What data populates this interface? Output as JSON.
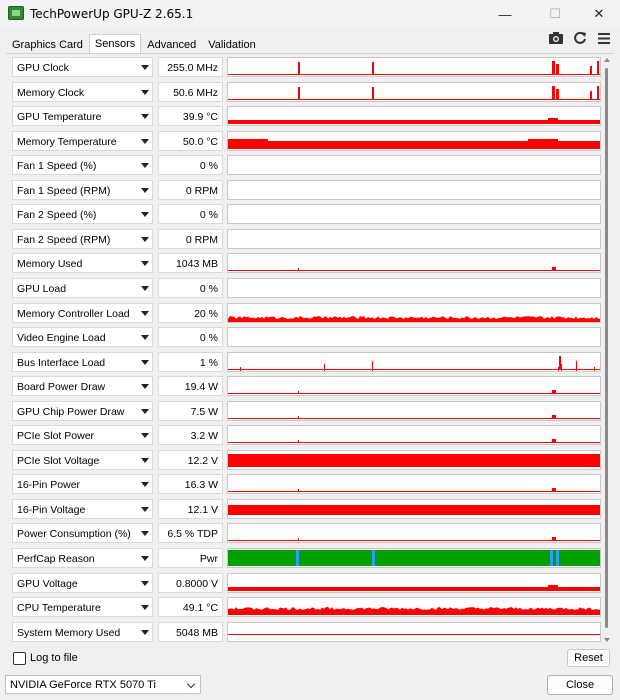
{
  "window": {
    "title": "TechPowerUp GPU-Z 2.65.1",
    "minimize_glyph": "—",
    "maximize_glyph": "☐",
    "close_glyph": "✕"
  },
  "tabs": [
    {
      "label": "Graphics Card"
    },
    {
      "label": "Sensors",
      "active": true
    },
    {
      "label": "Advanced"
    },
    {
      "label": "Validation"
    }
  ],
  "toolbar_icons": [
    "camera-icon",
    "refresh-icon",
    "menu-icon"
  ],
  "sensors": [
    {
      "name": "GPU Clock",
      "value": "255.0 MHz",
      "trend": "spikes"
    },
    {
      "name": "Memory Clock",
      "value": "50.6 MHz",
      "trend": "spikes"
    },
    {
      "name": "GPU Temperature",
      "value": "39.9 °C",
      "trend": "low-band"
    },
    {
      "name": "Memory Temperature",
      "value": "50.0 °C",
      "trend": "band"
    },
    {
      "name": "Fan 1 Speed (%)",
      "value": "0 %",
      "trend": "none"
    },
    {
      "name": "Fan 1 Speed (RPM)",
      "value": "0 RPM",
      "trend": "none"
    },
    {
      "name": "Fan 2 Speed (%)",
      "value": "0 %",
      "trend": "none"
    },
    {
      "name": "Fan 2 Speed (RPM)",
      "value": "0 RPM",
      "trend": "none"
    },
    {
      "name": "Memory Used",
      "value": "1043 MB",
      "trend": "line"
    },
    {
      "name": "GPU Load",
      "value": "0 %",
      "trend": "none"
    },
    {
      "name": "Memory Controller Load",
      "value": "20 %",
      "trend": "noisy"
    },
    {
      "name": "Video Engine Load",
      "value": "0 %",
      "trend": "none"
    },
    {
      "name": "Bus Interface Load",
      "value": "1 %",
      "trend": "spikes-small"
    },
    {
      "name": "Board Power Draw",
      "value": "19.4 W",
      "trend": "line"
    },
    {
      "name": "GPU Chip Power Draw",
      "value": "7.5 W",
      "trend": "line"
    },
    {
      "name": "PCIe Slot Power",
      "value": "3.2 W",
      "trend": "line"
    },
    {
      "name": "PCIe Slot Voltage",
      "value": "12.2 V",
      "trend": "full"
    },
    {
      "name": "16-Pin Power",
      "value": "16.3 W",
      "trend": "line"
    },
    {
      "name": "16-Pin Voltage",
      "value": "12.1 V",
      "trend": "full-low"
    },
    {
      "name": "Power Consumption (%)",
      "value": "6.5 % TDP",
      "trend": "line"
    },
    {
      "name": "PerfCap Reason",
      "value": "Pwr",
      "trend": "perfcap"
    },
    {
      "name": "GPU Voltage",
      "value": "0.8000 V",
      "trend": "low-band"
    },
    {
      "name": "CPU Temperature",
      "value": "49.1 °C",
      "trend": "noisy-band"
    },
    {
      "name": "System Memory Used",
      "value": "5048 MB",
      "trend": "mid-line"
    }
  ],
  "colors": {
    "graph_red": "#ff0000",
    "perfcap_green": "#00a000",
    "perfcap_blue": "#3399ff"
  },
  "footer": {
    "log_to_file_label": "Log to file",
    "log_to_file_checked": false,
    "reset_label": "Reset",
    "gpu_selected": "NVIDIA GeForce RTX 5070 Ti",
    "close_label": "Close"
  }
}
